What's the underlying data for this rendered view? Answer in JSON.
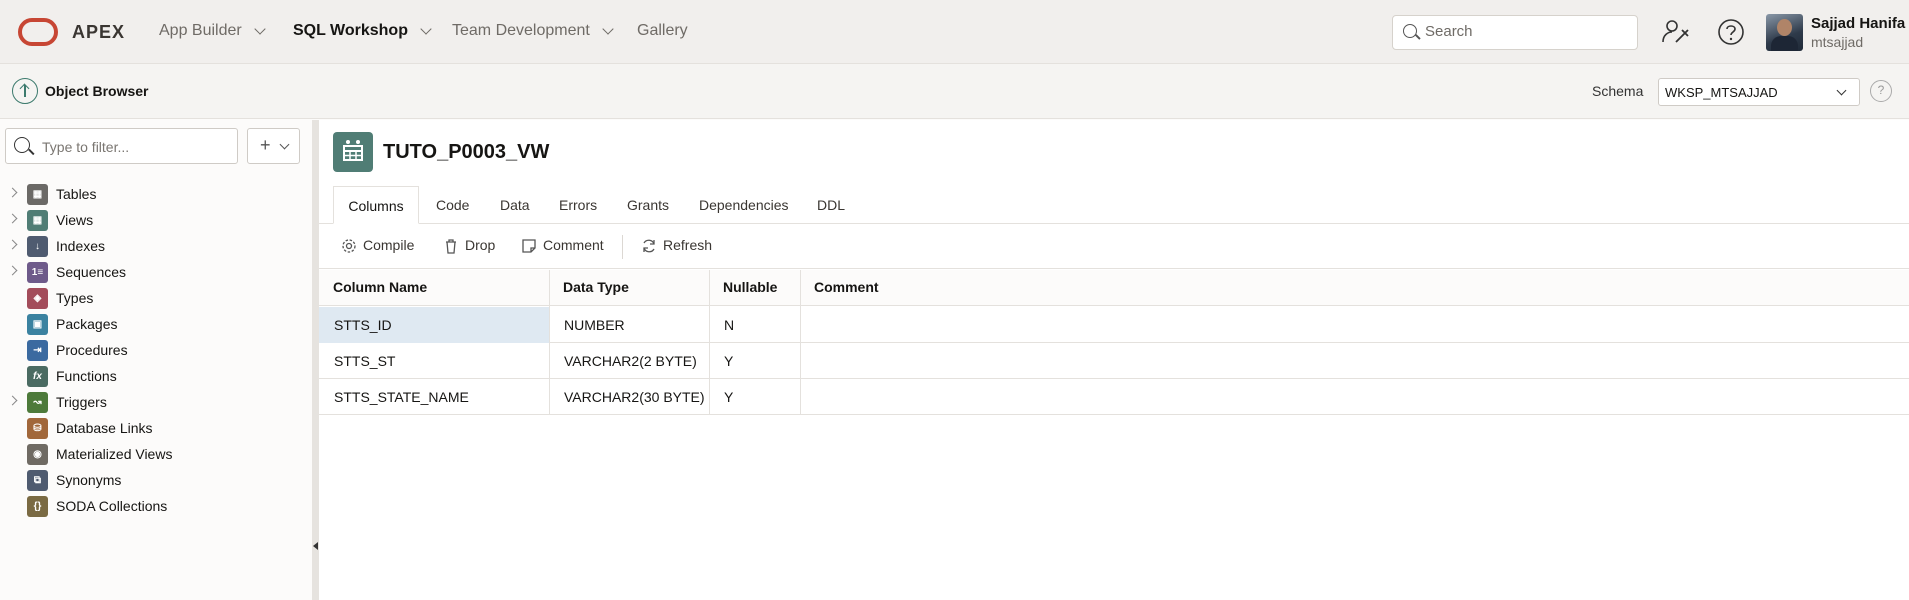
{
  "header": {
    "brand": "APEX",
    "nav": [
      {
        "label": "App Builder",
        "active": false
      },
      {
        "label": "SQL Workshop",
        "active": true
      },
      {
        "label": "Team Development",
        "active": false
      },
      {
        "label": "Gallery",
        "active": false
      }
    ],
    "search_placeholder": "Search",
    "user_name": "Sajjad Hanifa",
    "user_id": "mtsajjad"
  },
  "subbar": {
    "title": "Object Browser",
    "schema_label": "Schema",
    "schema_value": "WKSP_MTSAJJAD"
  },
  "sidebar": {
    "filter_placeholder": "Type to filter...",
    "add_label": "+",
    "items": [
      {
        "label": "Tables",
        "icon": "table-icon",
        "expandable": true,
        "color": "#6b6966"
      },
      {
        "label": "Views",
        "icon": "view-icon",
        "expandable": true,
        "color": "#507d75"
      },
      {
        "label": "Indexes",
        "icon": "index-icon",
        "expandable": true,
        "color": "#4f5b70"
      },
      {
        "label": "Sequences",
        "icon": "sequence-icon",
        "expandable": true,
        "color": "#6e5a8a"
      },
      {
        "label": "Types",
        "icon": "types-icon",
        "expandable": false,
        "color": "#a34c5a"
      },
      {
        "label": "Packages",
        "icon": "package-icon",
        "expandable": false,
        "color": "#3b82a0"
      },
      {
        "label": "Procedures",
        "icon": "procedure-icon",
        "expandable": false,
        "color": "#3b6aa0"
      },
      {
        "label": "Functions",
        "icon": "function-icon",
        "expandable": false,
        "color": "#4b6b62"
      },
      {
        "label": "Triggers",
        "icon": "trigger-icon",
        "expandable": true,
        "color": "#4d7a3a"
      },
      {
        "label": "Database Links",
        "icon": "database-link-icon",
        "expandable": false,
        "color": "#a1673a"
      },
      {
        "label": "Materialized Views",
        "icon": "materialized-view-icon",
        "expandable": false,
        "color": "#6f6a63"
      },
      {
        "label": "Synonyms",
        "icon": "synonym-icon",
        "expandable": false,
        "color": "#4f5b70"
      },
      {
        "label": "SODA Collections",
        "icon": "soda-collection-icon",
        "expandable": false,
        "color": "#7a6a43"
      }
    ]
  },
  "object": {
    "title": "TUTO_P0003_VW",
    "tabs": [
      "Columns",
      "Code",
      "Data",
      "Errors",
      "Grants",
      "Dependencies",
      "DDL"
    ],
    "active_tab": "Columns",
    "toolbar": [
      "Compile",
      "Drop",
      "Comment",
      "Refresh"
    ]
  },
  "grid": {
    "headers": [
      "Column Name",
      "Data Type",
      "Nullable",
      "Comment"
    ],
    "rows": [
      {
        "name": "STTS_ID",
        "type": "NUMBER",
        "nullable": "N",
        "comment": ""
      },
      {
        "name": "STTS_ST",
        "type": "VARCHAR2(2 BYTE)",
        "nullable": "Y",
        "comment": ""
      },
      {
        "name": "STTS_STATE_NAME",
        "type": "VARCHAR2(30 BYTE)",
        "nullable": "Y",
        "comment": ""
      }
    ]
  }
}
